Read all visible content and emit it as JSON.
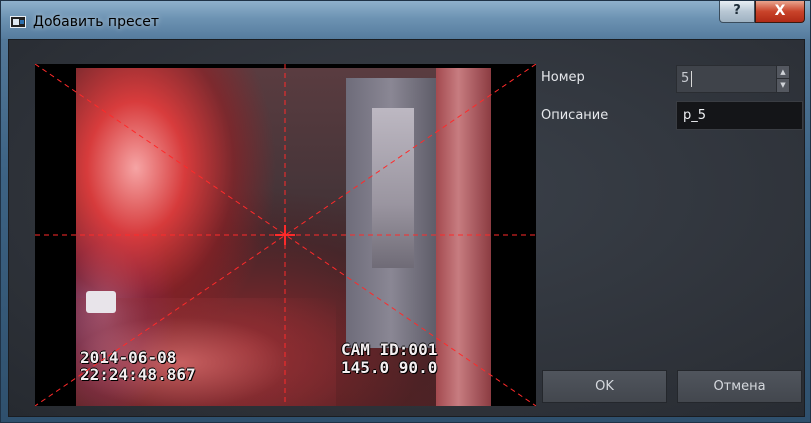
{
  "window": {
    "title": "Добавить пресет",
    "help_label": "?",
    "close_label": "X"
  },
  "video": {
    "osd_date": "2014-06-08",
    "osd_time": "22:24:48.867",
    "osd_cam": "CAM ID:001",
    "osd_position": "145.0 90.0",
    "crosshair_color": "#ff2a2a"
  },
  "form": {
    "number_label": "Номер",
    "number_value": "5",
    "description_label": "Описание",
    "description_value": "p_5"
  },
  "buttons": {
    "ok_label": "OK",
    "cancel_label": "Отмена"
  }
}
